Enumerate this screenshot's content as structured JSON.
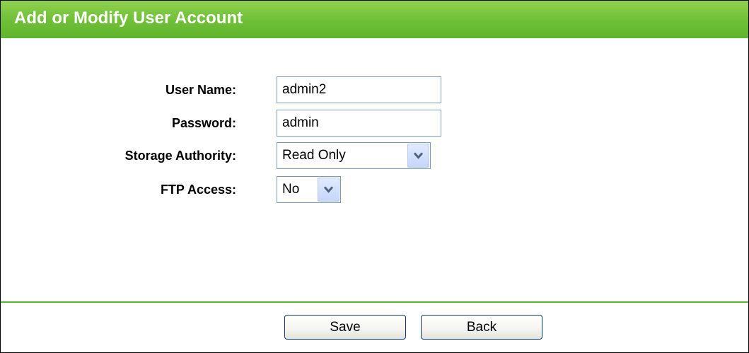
{
  "header": {
    "title": "Add or Modify User Account"
  },
  "form": {
    "username": {
      "label": "User Name:",
      "value": "admin2"
    },
    "password": {
      "label": "Password:",
      "value": "admin"
    },
    "storage_authority": {
      "label": "Storage Authority:",
      "selected": "Read Only"
    },
    "ftp_access": {
      "label": "FTP Access:",
      "selected": "No"
    }
  },
  "buttons": {
    "save_label": "Save",
    "back_label": "Back"
  },
  "colors": {
    "title_bar": "#6ebf36",
    "title_text": "#ffffff",
    "divider": "#5fb52c",
    "input_border": "#7f9db9",
    "button_border": "#003c74"
  },
  "icons": {
    "dropdown": "chevron-down-icon"
  }
}
